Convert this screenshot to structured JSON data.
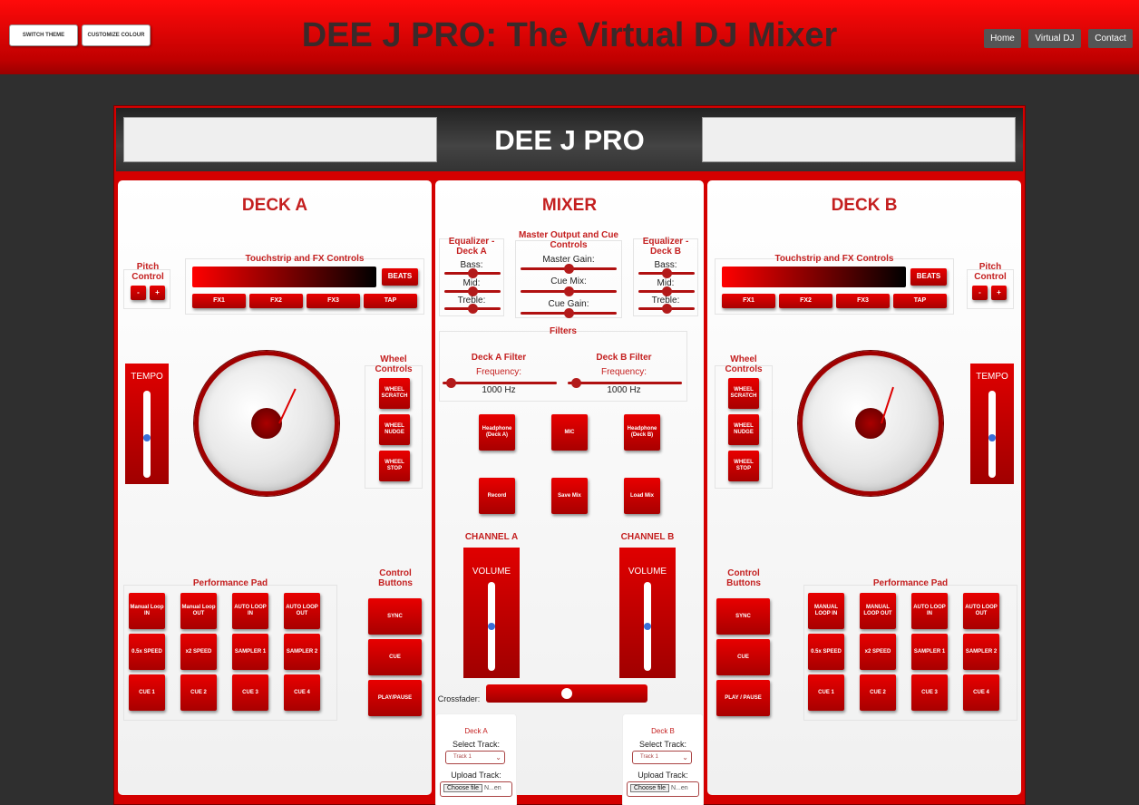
{
  "topbar": {
    "switch_theme": "SWITCH THEME",
    "customize_colour": "CUSTOMIZE COLOUR",
    "title": "DEE J PRO: The Virtual DJ Mixer",
    "nav": [
      "Home",
      "Virtual DJ",
      "Contact"
    ]
  },
  "brand": "DEE J PRO",
  "deck_a": {
    "title": "DECK A",
    "pitch_label": "Pitch Control",
    "pitch_minus": "-",
    "pitch_plus": "+",
    "touchstrip_label": "Touchstrip and FX Controls",
    "beats": "BEATS",
    "fx": [
      "FX1",
      "FX2",
      "FX3",
      "TAP"
    ],
    "tempo_label": "TEMPO",
    "tempo_level": 0.45,
    "wheel_label": "Wheel Controls",
    "wheel_buttons": [
      "WHEEL SCRATCH",
      "WHEEL NUDGE",
      "WHEEL STOP"
    ],
    "perf_label": "Performance Pad",
    "pads": [
      "Manual Loop IN",
      "Manual Loop OUT",
      "AUTO LOOP IN",
      "AUTO LOOP OUT",
      "0.5x SPEED",
      "x2 SPEED",
      "SAMPLER 1",
      "SAMPLER 2",
      "CUE 1",
      "CUE 2",
      "CUE 3",
      "CUE 4"
    ],
    "control_label": "Control Buttons",
    "controls": [
      "SYNC",
      "CUE",
      "PLAY/PAUSE"
    ]
  },
  "deck_b": {
    "title": "DECK B",
    "pitch_label": "Pitch Control",
    "pitch_minus": "-",
    "pitch_plus": "+",
    "touchstrip_label": "Touchstrip and FX Controls",
    "beats": "BEATS",
    "fx": [
      "FX1",
      "FX2",
      "FX3",
      "TAP"
    ],
    "tempo_label": "TEMPO",
    "tempo_level": 0.45,
    "wheel_label": "Wheel Controls",
    "wheel_buttons": [
      "WHEEL SCRATCH",
      "WHEEL NUDGE",
      "WHEEL STOP"
    ],
    "perf_label": "Performance Pad",
    "pads": [
      "MANUAL LOOP IN",
      "MANUAL LOOP OUT",
      "AUTO LOOP IN",
      "AUTO LOOP OUT",
      "0.5x SPEED",
      "x2 SPEED",
      "SAMPLER 1",
      "SAMPLER 2",
      "CUE 1",
      "CUE 2",
      "CUE 3",
      "CUE 4"
    ],
    "control_label": "Control Buttons",
    "controls": [
      "SYNC",
      "CUE",
      "PLAY / PAUSE"
    ]
  },
  "mixer": {
    "title": "MIXER",
    "eq_a": "Equalizer - Deck A",
    "eq_b": "Equalizer - Deck B",
    "master": "Master Output and Cue Controls",
    "bass": "Bass:",
    "mid": "Mid:",
    "treble": "Treble:",
    "master_gain": "Master Gain:",
    "cue_mix": "Cue Mix:",
    "cue_gain": "Cue Gain:",
    "filters": "Filters",
    "deck_a_filter": "Deck A Filter",
    "deck_b_filter": "Deck B Filter",
    "frequency": "Frequency:",
    "freq_a": "1000 Hz",
    "freq_b": "1000 Hz",
    "buttons": [
      "Headphone (Deck A)",
      "MIC",
      "Headphone (Deck B)",
      "Record",
      "Save Mix",
      "Load Mix"
    ],
    "channel_a": "CHANNEL A",
    "channel_b": "CHANNEL B",
    "volume": "VOLUME",
    "volume_level": 0.5,
    "crossfader": "Crossfader:",
    "crossfader_level": 0.5,
    "card_a": {
      "title": "Deck A",
      "select_label": "Select Track:",
      "select_value": "Track 1",
      "upload_label": "Upload Track:",
      "choose": "Choose file",
      "file": "N...en"
    },
    "card_b": {
      "title": "Deck B",
      "select_label": "Select Track:",
      "select_value": "Track 1",
      "upload_label": "Upload Track:",
      "choose": "Choose file",
      "file": "N...en"
    }
  },
  "colors": {
    "accent": "#d40000",
    "title_red": "#c41f1f",
    "knob_blue": "#3a6fd8"
  }
}
